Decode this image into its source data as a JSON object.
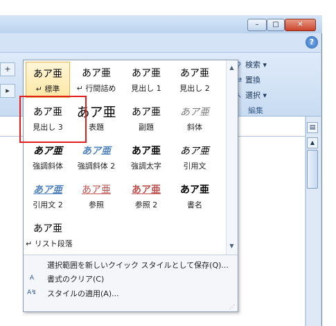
{
  "window": {
    "title_buttons": {
      "minimize": "–",
      "maximize": "□",
      "close": "✕"
    },
    "help": "?",
    "left_buttons": [
      "+",
      "▸"
    ]
  },
  "editing_group": {
    "find": "検索",
    "replace": "置換",
    "select": "選択",
    "label": "編集"
  },
  "styles_gallery": {
    "styles": [
      {
        "sample": "あア亜",
        "name": "↵ 標準",
        "variant": "normal",
        "selected": true
      },
      {
        "sample": "あア亜",
        "name": "↵ 行間詰め",
        "variant": "normal"
      },
      {
        "sample": "あア亜",
        "name": "見出し 1",
        "variant": "normal"
      },
      {
        "sample": "あア亜",
        "name": "見出し 2",
        "variant": "normal"
      },
      {
        "sample": "あア亜",
        "name": "見出し 3",
        "variant": "normal"
      },
      {
        "sample": "あア亜",
        "name": "表題",
        "variant": "title-s"
      },
      {
        "sample": "あア亜",
        "name": "副題",
        "variant": "normal"
      },
      {
        "sample": "あア亜",
        "name": "斜体",
        "variant": "italic gray"
      },
      {
        "sample": "あア亜",
        "name": "強調斜体",
        "variant": "italic bold"
      },
      {
        "sample": "あア亜",
        "name": "強調斜体 2",
        "variant": "italic bold blue"
      },
      {
        "sample": "あア亜",
        "name": "強調太字",
        "variant": "bold"
      },
      {
        "sample": "あア亜",
        "name": "引用文",
        "variant": "italic"
      },
      {
        "sample": "あア亜",
        "name": "引用文 2",
        "variant": "italic bold blue-u"
      },
      {
        "sample": "あア亜",
        "name": "参照",
        "variant": "red-u"
      },
      {
        "sample": "あア亜",
        "name": "参照 2",
        "variant": "bold red-u"
      },
      {
        "sample": "あア亜",
        "name": "書名",
        "variant": "heavy"
      },
      {
        "sample": "あア亜",
        "name": "↵ リスト段落",
        "variant": "normal"
      }
    ],
    "menu": [
      {
        "icon": "save-style-icon",
        "label": "選択範囲を新しいクイック スタイルとして保存(Q)..."
      },
      {
        "icon": "clear-format-icon",
        "label": "書式のクリア(C)"
      },
      {
        "icon": "apply-style-icon",
        "label": "スタイルの適用(A)..."
      }
    ]
  },
  "highlight_color": "#e21b1b"
}
